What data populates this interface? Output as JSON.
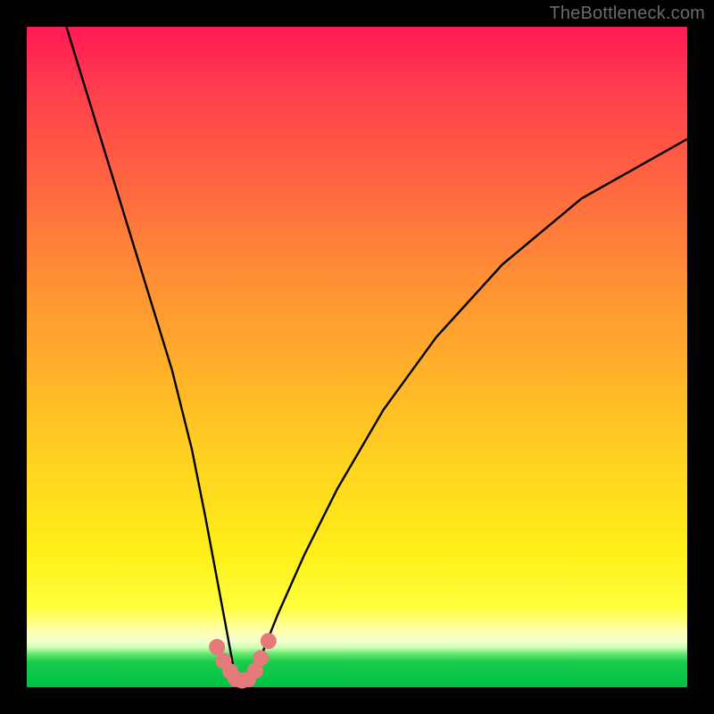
{
  "watermark": "TheBottleneck.com",
  "chart_data": {
    "type": "line",
    "title": "",
    "xlabel": "",
    "ylabel": "",
    "xlim": [
      0,
      100
    ],
    "ylim": [
      0,
      100
    ],
    "series": [
      {
        "name": "bottleneck-curve",
        "x": [
          6,
          10,
          14,
          18,
          22,
          25,
          27,
          28.5,
          30,
          31.3,
          32.2,
          33.2,
          34.5,
          36,
          38,
          42,
          47,
          54,
          62,
          72,
          84,
          100
        ],
        "values": [
          100,
          87,
          74,
          61,
          48,
          36,
          26,
          18,
          10,
          3,
          0.5,
          0.5,
          2.3,
          6,
          11,
          20,
          30,
          42,
          53,
          64,
          74,
          83
        ]
      }
    ],
    "markers": {
      "name": "highlight-dots",
      "x": [
        28.8,
        29.8,
        30.8,
        31.6,
        32.6,
        33.5,
        34.6,
        35.4,
        36.6
      ],
      "values": [
        6.1,
        4.0,
        2.4,
        1.3,
        1.0,
        1.2,
        2.5,
        4.4,
        7.0
      ],
      "color": "#e47a7a",
      "radius_px": 9
    },
    "background_gradient": {
      "direction": "top-to-bottom",
      "stops": [
        {
          "pos": 0.0,
          "color": "#ff1a55"
        },
        {
          "pos": 0.25,
          "color": "#ff6a3f"
        },
        {
          "pos": 0.52,
          "color": "#ffb12a"
        },
        {
          "pos": 0.8,
          "color": "#fff018"
        },
        {
          "pos": 0.92,
          "color": "#ffffb0"
        },
        {
          "pos": 0.95,
          "color": "#60e66a"
        },
        {
          "pos": 1.0,
          "color": "#00c244"
        }
      ]
    }
  }
}
